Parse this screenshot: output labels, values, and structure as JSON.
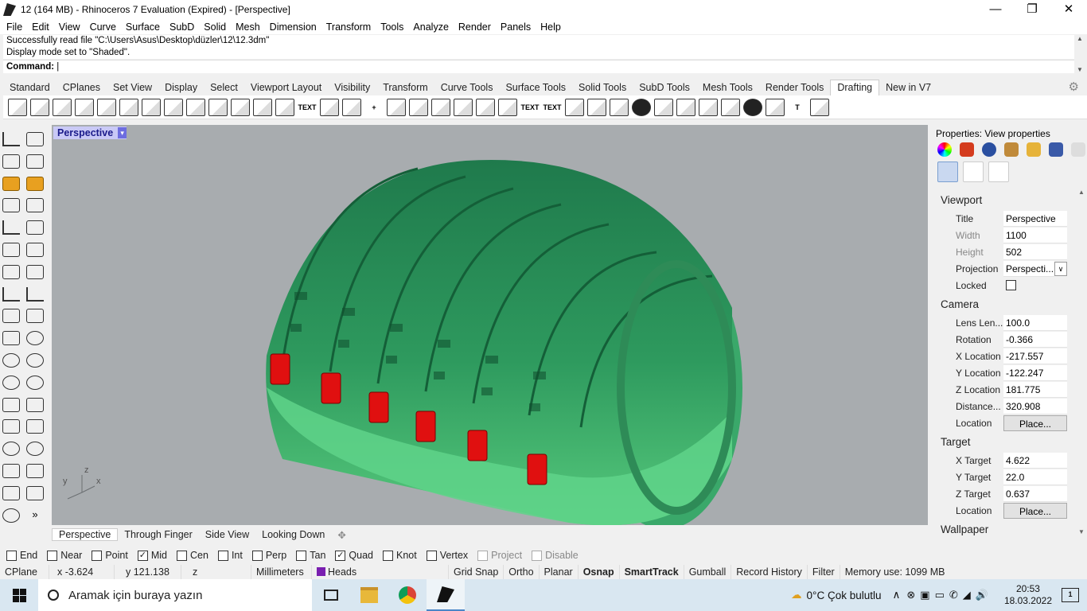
{
  "window": {
    "title": "12 (164 MB) - Rhinoceros 7 Evaluation (Expired) - [Perspective]",
    "minimize": "—",
    "maximize": "❐",
    "close": "✕"
  },
  "menu": [
    "File",
    "Edit",
    "View",
    "Curve",
    "Surface",
    "SubD",
    "Solid",
    "Mesh",
    "Dimension",
    "Transform",
    "Tools",
    "Analyze",
    "Render",
    "Panels",
    "Help"
  ],
  "command": {
    "history": [
      "Successfully read file \"C:\\Users\\Asus\\Desktop\\düzler\\12\\12.3dm\"",
      "Display mode set to \"Shaded\"."
    ],
    "prompt": "Command:"
  },
  "toolbar_tabs": [
    "Standard",
    "CPlanes",
    "Set View",
    "Display",
    "Select",
    "Viewport Layout",
    "Visibility",
    "Transform",
    "Curve Tools",
    "Surface Tools",
    "Solid Tools",
    "SubD Tools",
    "Mesh Tools",
    "Render Tools",
    "Drafting",
    "New in V7"
  ],
  "active_tab": "Drafting",
  "viewport": {
    "title": "Perspective",
    "bottom_tabs": [
      "Perspective",
      "Through Finger",
      "Side View",
      "Looking Down"
    ],
    "add_tab": "✥",
    "axis_labels": {
      "z": "z",
      "y": "y",
      "x": "x"
    },
    "object_color": "#2e8b57",
    "accent_color": "#e01010"
  },
  "properties": {
    "title": "Properties: View properties",
    "sections": {
      "viewport": "Viewport",
      "camera": "Camera",
      "target": "Target",
      "wallpaper": "Wallpaper"
    },
    "viewport_rows": [
      {
        "label": "Title",
        "value": "Perspective"
      },
      {
        "label": "Width",
        "value": "1100"
      },
      {
        "label": "Height",
        "value": "502"
      },
      {
        "label": "Projection",
        "value": "Perspecti..."
      },
      {
        "label": "Locked",
        "value": ""
      }
    ],
    "camera_rows": [
      {
        "label": "Lens Len...",
        "value": "100.0"
      },
      {
        "label": "Rotation",
        "value": "-0.366"
      },
      {
        "label": "X Location",
        "value": "-217.557"
      },
      {
        "label": "Y Location",
        "value": "-122.247"
      },
      {
        "label": "Z Location",
        "value": "181.775"
      },
      {
        "label": "Distance...",
        "value": "320.908"
      },
      {
        "label": "Location",
        "value": "Place..."
      }
    ],
    "target_rows": [
      {
        "label": "X Target",
        "value": "4.622"
      },
      {
        "label": "Y Target",
        "value": "22.0"
      },
      {
        "label": "Z Target",
        "value": "0.637"
      },
      {
        "label": "Location",
        "value": "Place..."
      }
    ]
  },
  "osnap": [
    {
      "label": "End",
      "checked": false
    },
    {
      "label": "Near",
      "checked": false
    },
    {
      "label": "Point",
      "checked": false
    },
    {
      "label": "Mid",
      "checked": true
    },
    {
      "label": "Cen",
      "checked": false
    },
    {
      "label": "Int",
      "checked": false
    },
    {
      "label": "Perp",
      "checked": false
    },
    {
      "label": "Tan",
      "checked": false
    },
    {
      "label": "Quad",
      "checked": true
    },
    {
      "label": "Knot",
      "checked": false
    },
    {
      "label": "Vertex",
      "checked": false
    },
    {
      "label": "Project",
      "checked": false
    },
    {
      "label": "Disable",
      "checked": false
    }
  ],
  "status": {
    "cplane": "CPlane",
    "x": "x -3.624",
    "y": "y 121.138",
    "z": "z",
    "units": "Millimeters",
    "layer": "Heads",
    "layer_color": "#7a1fb0",
    "grid_snap": "Grid Snap",
    "ortho": "Ortho",
    "planar": "Planar",
    "osnap": "Osnap",
    "smarttrack": "SmartTrack",
    "gumball": "Gumball",
    "record_history": "Record History",
    "filter": "Filter",
    "memory": "Memory use: 1099 MB"
  },
  "taskbar": {
    "search_placeholder": "Aramak için buraya yazın",
    "weather": "0°C  Çok bulutlu",
    "time": "20:53",
    "date": "18.03.2022",
    "notifications": "1"
  }
}
